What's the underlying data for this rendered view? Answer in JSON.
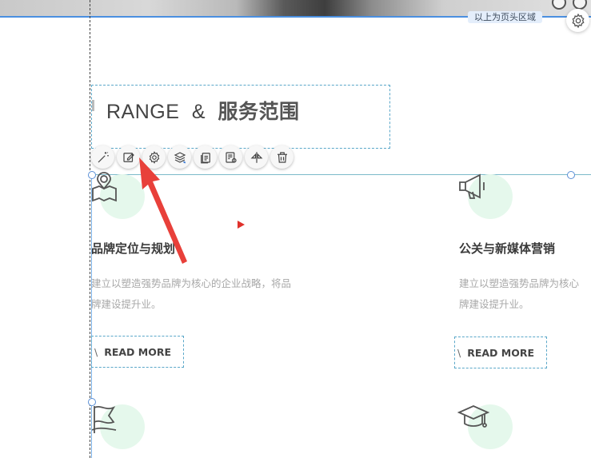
{
  "header": {
    "region_label": "以上为页头区域",
    "settings_icon": "gear-icon"
  },
  "section": {
    "title_en": "RANGE",
    "title_sep": "&",
    "title_cn": "服务范围"
  },
  "toolbar": {
    "tools": [
      {
        "name": "magic-wand-icon"
      },
      {
        "name": "edit-icon"
      },
      {
        "name": "settings-icon"
      },
      {
        "name": "layers-icon"
      },
      {
        "name": "copy-icon"
      },
      {
        "name": "content-settings-icon"
      },
      {
        "name": "flip-icon"
      },
      {
        "name": "delete-icon"
      }
    ]
  },
  "services": [
    {
      "icon": "map-location-icon",
      "title": "品牌定位与规划",
      "desc_line1": "建立以塑造强势品牌为核心的企业战略，将品",
      "desc_line2": "牌建设提升业。",
      "more_label": "READ MORE"
    },
    {
      "icon": "megaphone-icon",
      "title": "公关与新媒体营销",
      "desc_line1": "建立以塑造强势品牌为核心",
      "desc_line2": "牌建设提升业。",
      "more_label": "READ MORE"
    },
    {
      "icon": "flag-icon"
    },
    {
      "icon": "graduation-cap-icon"
    }
  ],
  "colors": {
    "accent_blue": "#4a8fe0",
    "dashed_outline": "#5aa7c9",
    "icon_circle": "#e5f8ec",
    "annotation_arrow": "#e8403a"
  }
}
